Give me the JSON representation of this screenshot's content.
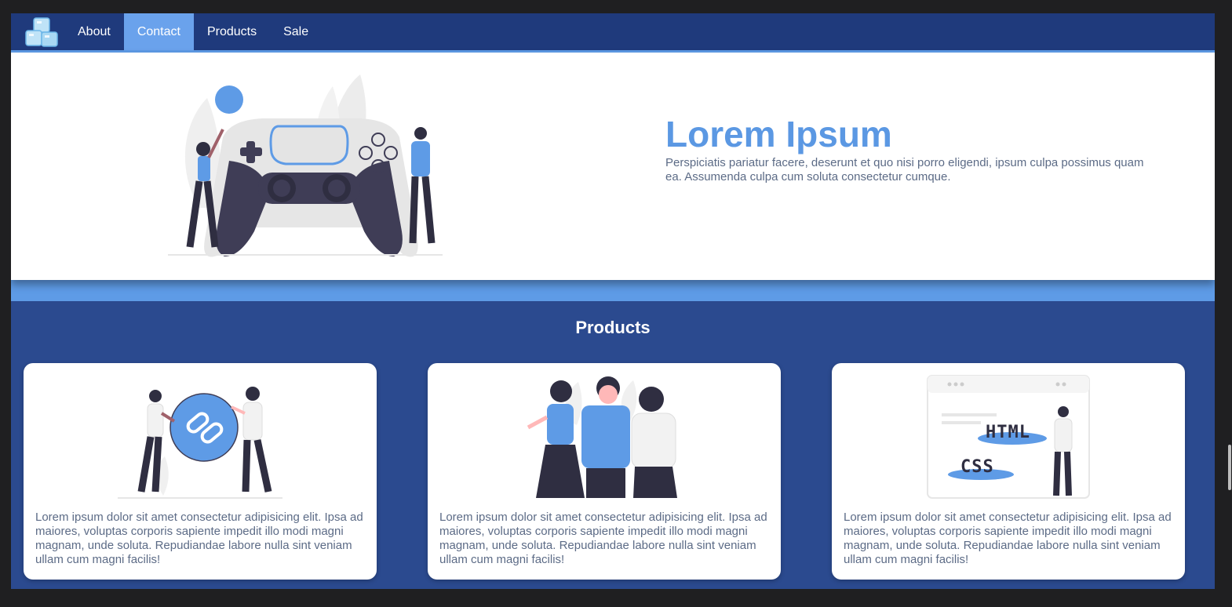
{
  "nav": {
    "logo": "ice-cubes-logo",
    "items": [
      {
        "label": "About",
        "active": false
      },
      {
        "label": "Contact",
        "active": true
      },
      {
        "label": "Products",
        "active": false
      },
      {
        "label": "Sale",
        "active": false
      }
    ]
  },
  "hero": {
    "title": "Lorem Ipsum",
    "description": "Perspiciatis pariatur facere, deserunt et quo nisi porro eligendi, ipsum culpa possimus quam ea. Assumenda culpa cum soluta consectetur cumque.",
    "illustration": "game-controller-illustration"
  },
  "products": {
    "title": "Products",
    "cards": [
      {
        "illustration": "link-illustration",
        "text": "Lorem ipsum dolor sit amet consectetur adipisicing elit. Ipsa ad maiores, voluptas corporis sapiente impedit illo modi magni magnam, unde soluta. Repudiandae labore nulla sint veniam ullam cum magni facilis!"
      },
      {
        "illustration": "team-illustration",
        "text": "Lorem ipsum dolor sit amet consectetur adipisicing elit. Ipsa ad maiores, voluptas corporis sapiente impedit illo modi magni magnam, unde soluta. Repudiandae labore nulla sint veniam ullam cum magni facilis!"
      },
      {
        "illustration": "html-css-illustration",
        "html_label": "HTML",
        "css_label": "CSS",
        "text": "Lorem ipsum dolor sit amet consectetur adipisicing elit. Ipsa ad maiores, voluptas corporis sapiente impedit illo modi magni magnam, unde soluta. Repudiandae labore nulla sint veniam ullam cum magni facilis!"
      }
    ]
  },
  "colors": {
    "navbar": "#1f3a7c",
    "accent": "#5e9be6",
    "section_bg": "#2b4a8f",
    "title_blue": "#5b98e3",
    "dark": "#2f2e41"
  }
}
